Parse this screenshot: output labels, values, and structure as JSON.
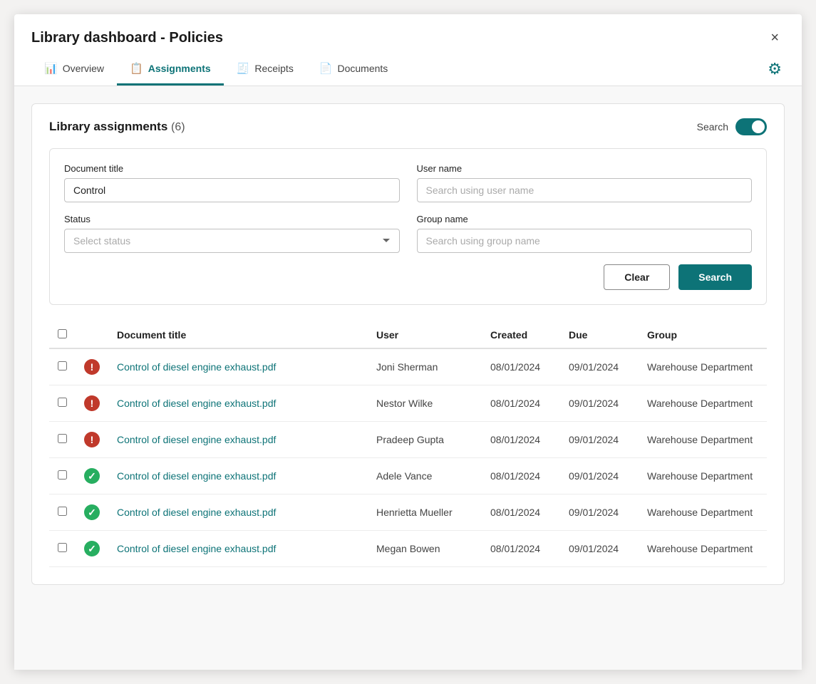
{
  "modal": {
    "title": "Library dashboard - Policies",
    "close_label": "×"
  },
  "tabs": [
    {
      "id": "overview",
      "label": "Overview",
      "icon": "📊",
      "active": false
    },
    {
      "id": "assignments",
      "label": "Assignments",
      "icon": "📋",
      "active": true
    },
    {
      "id": "receipts",
      "label": "Receipts",
      "icon": "🧾",
      "active": false
    },
    {
      "id": "documents",
      "label": "Documents",
      "icon": "📄",
      "active": false
    }
  ],
  "gear_label": "⚙",
  "card": {
    "title": "Library assignments",
    "count": "(6)",
    "search_toggle_label": "Search"
  },
  "form": {
    "doc_title_label": "Document title",
    "doc_title_value": "Control",
    "user_name_label": "User name",
    "user_name_placeholder": "Search using user name",
    "status_label": "Status",
    "status_placeholder": "Select status",
    "group_name_label": "Group name",
    "group_name_placeholder": "Search using group name",
    "clear_label": "Clear",
    "search_label": "Search"
  },
  "table": {
    "columns": [
      {
        "id": "checkbox",
        "label": ""
      },
      {
        "id": "status",
        "label": ""
      },
      {
        "id": "doc_title",
        "label": "Document title"
      },
      {
        "id": "user",
        "label": "User"
      },
      {
        "id": "created",
        "label": "Created"
      },
      {
        "id": "due",
        "label": "Due"
      },
      {
        "id": "group",
        "label": "Group"
      }
    ],
    "rows": [
      {
        "status": "error",
        "doc_title": "Control of diesel engine exhaust.pdf",
        "user": "Joni Sherman",
        "created": "08/01/2024",
        "due": "09/01/2024",
        "group": "Warehouse Department"
      },
      {
        "status": "error",
        "doc_title": "Control of diesel engine exhaust.pdf",
        "user": "Nestor Wilke",
        "created": "08/01/2024",
        "due": "09/01/2024",
        "group": "Warehouse Department"
      },
      {
        "status": "error",
        "doc_title": "Control of diesel engine exhaust.pdf",
        "user": "Pradeep Gupta",
        "created": "08/01/2024",
        "due": "09/01/2024",
        "group": "Warehouse Department"
      },
      {
        "status": "ok",
        "doc_title": "Control of diesel engine exhaust.pdf",
        "user": "Adele Vance",
        "created": "08/01/2024",
        "due": "09/01/2024",
        "group": "Warehouse Department"
      },
      {
        "status": "ok",
        "doc_title": "Control of diesel engine exhaust.pdf",
        "user": "Henrietta Mueller",
        "created": "08/01/2024",
        "due": "09/01/2024",
        "group": "Warehouse Department"
      },
      {
        "status": "ok",
        "doc_title": "Control of diesel engine exhaust.pdf",
        "user": "Megan Bowen",
        "created": "08/01/2024",
        "due": "09/01/2024",
        "group": "Warehouse Department"
      }
    ]
  }
}
